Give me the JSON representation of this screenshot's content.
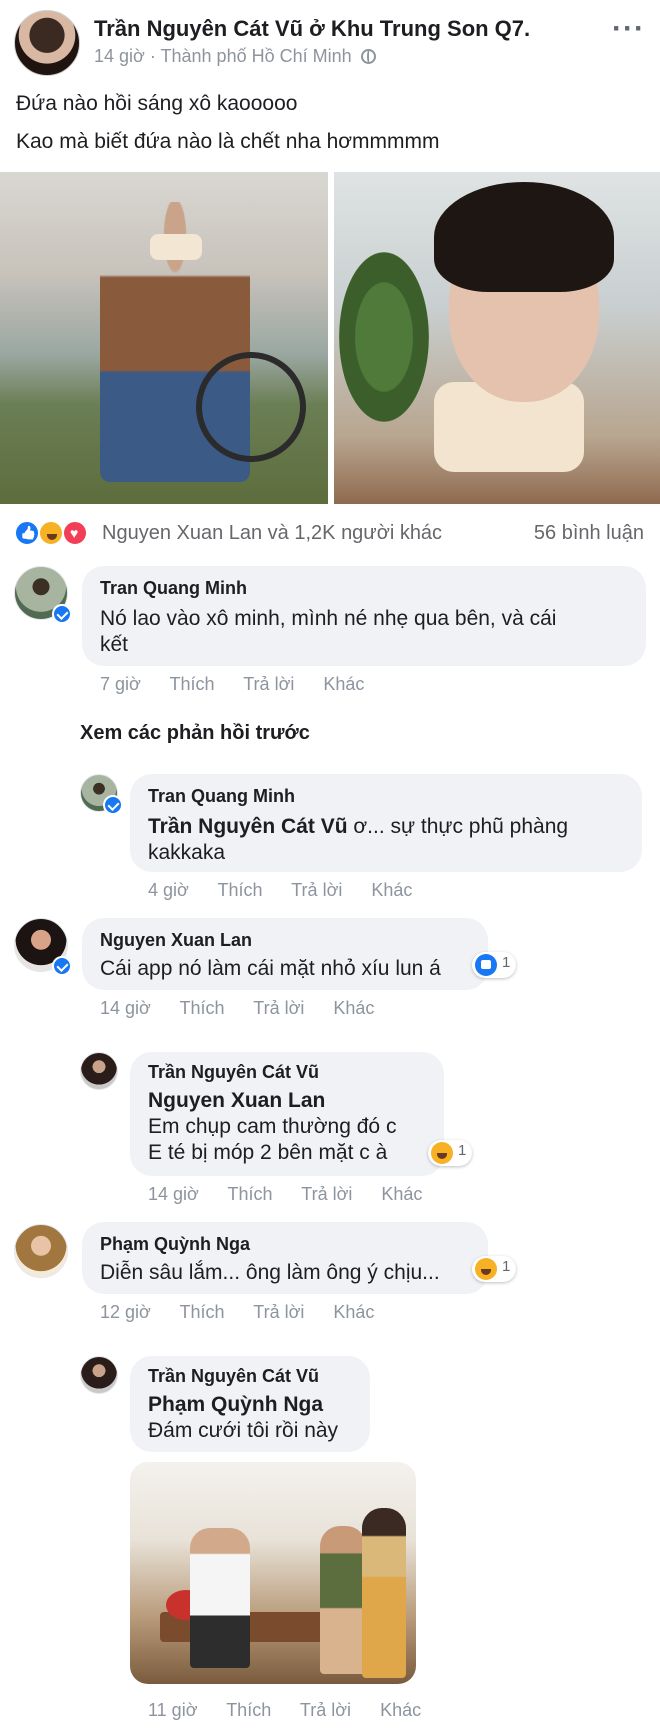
{
  "post": {
    "author": "Trần Nguyên Cát Vũ",
    "location": "ở Khu Trung Son Q7.",
    "time": "14 giờ",
    "place": "Thành phố Hồ Chí Minh",
    "text_lines": [
      "Đứa nào hồi sáng xô kaooooo",
      "Kao mà biết đứa nào là chết nha hơmmmmm"
    ],
    "reactions_text": "Nguyen Xuan Lan và 1,2K người khác",
    "comment_count": "56 bình luận",
    "icons": [
      "like-icon",
      "haha-icon",
      "love-icon",
      "globe-icon",
      "more-icon"
    ]
  },
  "actions": {
    "like": "Thích",
    "reply": "Trả lời",
    "more": "Khác"
  },
  "comments": [
    {
      "name": "Tran Quang Minh",
      "lines": [
        "Nó lao vào xô minh, mình né nhẹ qua bên, và cái",
        "kết"
      ],
      "time": "7 giờ"
    },
    {
      "view_previous": "Xem các phản hồi trước",
      "name": "Tran Quang Minh",
      "tag": "Trần Nguyên Cát Vũ",
      "lines": [
        "ơ... sự thực phũ phàng",
        "kakkaka"
      ],
      "time": "4 giờ"
    },
    {
      "name": "Nguyen Xuan Lan",
      "lines": [
        "Cái app nó làm cái mặt nhỏ xíu lun á"
      ],
      "time": "14 giờ",
      "reaction_count": "1"
    },
    {
      "name": "Trần Nguyên Cát Vũ",
      "tag": "Nguyen Xuan Lan",
      "lines": [
        "Em chụp cam thường đó c",
        "E té bị móp 2 bên mặt c à"
      ],
      "time": "14 giờ",
      "reaction_count": "1"
    },
    {
      "name": "Phạm Quỳnh Nga",
      "lines": [
        "Diễn sâu lắm... ông làm ông ý chịu..."
      ],
      "time": "12 giờ",
      "reaction_count": "1"
    },
    {
      "name": "Trần Nguyên Cát Vũ",
      "tag": "Phạm Quỳnh Nga",
      "lines": [
        "Đám cưới tôi rồi này"
      ],
      "time": "11 giờ"
    }
  ],
  "colors": {
    "accent": "#1877f2",
    "bubble": "#f0f2f5",
    "meta": "#8d949e"
  }
}
